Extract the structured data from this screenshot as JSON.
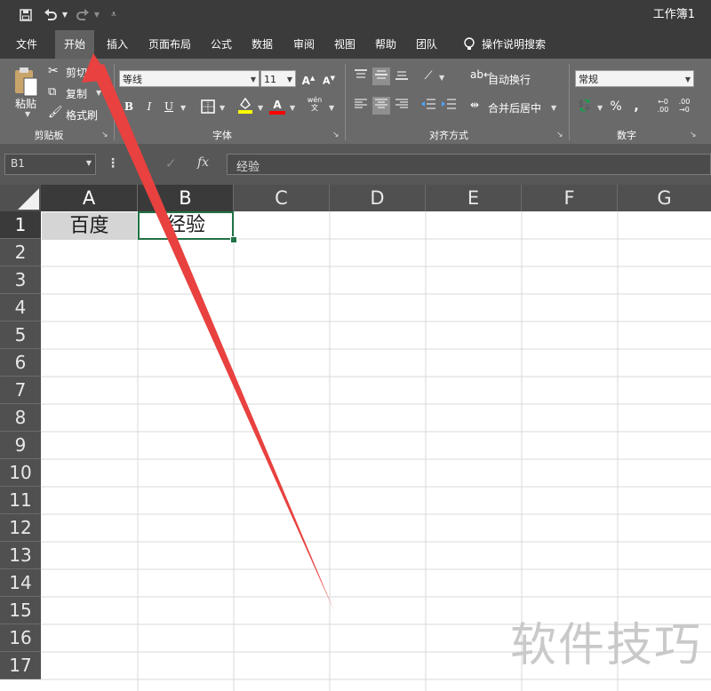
{
  "window": {
    "title": "工作簿1"
  },
  "quick_access": {
    "save_icon": "save-icon",
    "undo_icon": "undo-icon",
    "redo_icon": "redo-icon",
    "customize_icon": "customize-icon"
  },
  "tabs": [
    "文件",
    "开始",
    "插入",
    "页面布局",
    "公式",
    "数据",
    "审阅",
    "视图",
    "帮助",
    "团队"
  ],
  "active_tab": "开始",
  "tell_me": {
    "label": "操作说明搜索",
    "icon": "lightbulb-icon"
  },
  "clipboard": {
    "paste": "粘贴",
    "cut": "剪切",
    "copy": "复制",
    "format_painter": "格式刷",
    "group": "剪贴板"
  },
  "font": {
    "name": "等线",
    "size": "11",
    "group": "字体",
    "phonetic": "wén\n文"
  },
  "alignment": {
    "wrap": "自动换行",
    "merge": "合并后居中",
    "group": "对齐方式"
  },
  "number": {
    "format": "常规",
    "group": "数字",
    "percent": "%",
    "comma": ",",
    "inc_decimal": "←0\n.00",
    "dec_decimal": ".00\n→0"
  },
  "formula_bar": {
    "name_box": "B1",
    "content": "经验",
    "fx": "fx"
  },
  "columns": [
    "A",
    "B",
    "C",
    "D",
    "E",
    "F",
    "G"
  ],
  "rows": [
    "1",
    "2",
    "3",
    "4",
    "5",
    "6",
    "7",
    "8",
    "9",
    "10",
    "11",
    "12",
    "13",
    "14",
    "15",
    "16",
    "17"
  ],
  "cells": {
    "A1": "百度",
    "B1": "经验"
  },
  "selected_cell": "B1",
  "colors": {
    "chrome_dark": "#3b3b3b",
    "ribbon": "#6a6a6a",
    "arrow": "#e8413f",
    "selection": "#217346"
  },
  "watermark": "软件技巧"
}
